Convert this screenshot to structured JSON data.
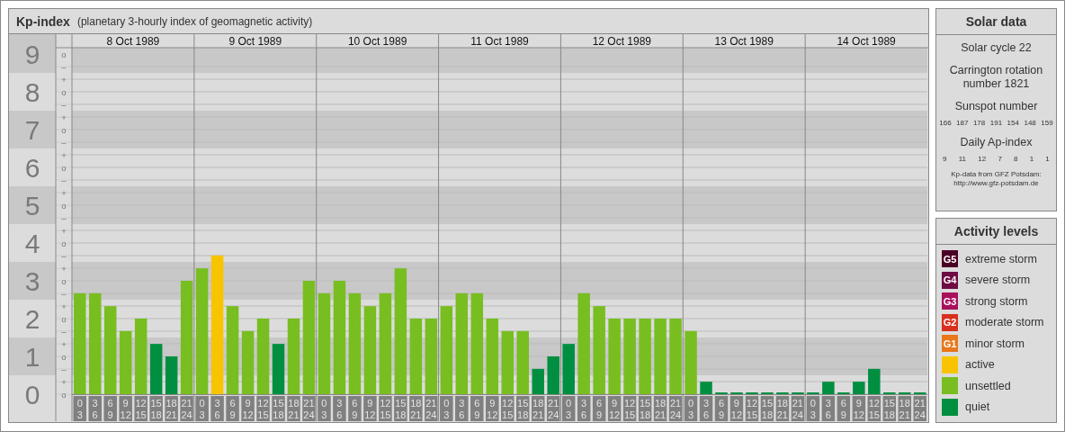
{
  "header": {
    "subtitle": "(planetary 3-hourly index of geomagnetic activity)"
  },
  "kp_chart": {
    "days": [
      {
        "date": "8 Oct 1989",
        "slots": [
          {
            "from": "0",
            "to": "3"
          },
          {
            "from": "3",
            "to": "6"
          },
          {
            "from": "6",
            "to": "9"
          },
          {
            "from": "9",
            "to": "12"
          },
          {
            "from": "12",
            "to": "15"
          },
          {
            "from": "15",
            "to": "18"
          },
          {
            "from": "18",
            "to": "21"
          },
          {
            "from": "21",
            "to": "24"
          }
        ]
      },
      {
        "date": "9 Oct 1989",
        "slots": [
          {
            "from": "0",
            "to": "3"
          },
          {
            "from": "3",
            "to": "6"
          },
          {
            "from": "6",
            "to": "9"
          },
          {
            "from": "9",
            "to": "12"
          },
          {
            "from": "12",
            "to": "15"
          },
          {
            "from": "15",
            "to": "18"
          },
          {
            "from": "18",
            "to": "21"
          },
          {
            "from": "21",
            "to": "24"
          }
        ]
      },
      {
        "date": "10 Oct 1989",
        "slots": [
          {
            "from": "0",
            "to": "3"
          },
          {
            "from": "3",
            "to": "6"
          },
          {
            "from": "6",
            "to": "9"
          },
          {
            "from": "9",
            "to": "12"
          },
          {
            "from": "12",
            "to": "15"
          },
          {
            "from": "15",
            "to": "18"
          },
          {
            "from": "18",
            "to": "21"
          },
          {
            "from": "21",
            "to": "24"
          }
        ]
      },
      {
        "date": "11 Oct 1989",
        "slots": [
          {
            "from": "0",
            "to": "3"
          },
          {
            "from": "3",
            "to": "6"
          },
          {
            "from": "6",
            "to": "9"
          },
          {
            "from": "9",
            "to": "12"
          },
          {
            "from": "12",
            "to": "15"
          },
          {
            "from": "15",
            "to": "18"
          },
          {
            "from": "18",
            "to": "21"
          },
          {
            "from": "21",
            "to": "24"
          }
        ]
      },
      {
        "date": "12 Oct 1989",
        "slots": [
          {
            "from": "0",
            "to": "3"
          },
          {
            "from": "3",
            "to": "6"
          },
          {
            "from": "6",
            "to": "9"
          },
          {
            "from": "9",
            "to": "12"
          },
          {
            "from": "12",
            "to": "15"
          },
          {
            "from": "15",
            "to": "18"
          },
          {
            "from": "18",
            "to": "21"
          },
          {
            "from": "21",
            "to": "24"
          }
        ]
      },
      {
        "date": "13 Oct 1989",
        "slots": [
          {
            "from": "0",
            "to": "3"
          },
          {
            "from": "3",
            "to": "6"
          },
          {
            "from": "6",
            "to": "9"
          },
          {
            "from": "9",
            "to": "12"
          },
          {
            "from": "12",
            "to": "15"
          },
          {
            "from": "15",
            "to": "18"
          },
          {
            "from": "18",
            "to": "21"
          },
          {
            "from": "21",
            "to": "24"
          }
        ]
      },
      {
        "date": "14 Oct 1989",
        "slots": [
          {
            "from": "0",
            "to": "3"
          },
          {
            "from": "3",
            "to": "6"
          },
          {
            "from": "6",
            "to": "9"
          },
          {
            "from": "9",
            "to": "12"
          },
          {
            "from": "12",
            "to": "15"
          },
          {
            "from": "15",
            "to": "18"
          },
          {
            "from": "18",
            "to": "21"
          },
          {
            "from": "21",
            "to": "24"
          }
        ]
      }
    ],
    "minor_ticks": [
      "o",
      "–",
      "+",
      "o",
      "–",
      "+",
      "o",
      "–",
      "+",
      "o",
      "–",
      "+",
      "o",
      "–",
      "+",
      "o",
      "–",
      "+",
      "o",
      "–",
      "+",
      "o",
      "–",
      "+",
      "o",
      "–",
      "+",
      "o"
    ],
    "chart_data": {
      "type": "bar",
      "title": "Kp-index",
      "ylim": [
        0,
        9.1667
      ],
      "grid": true,
      "yticks": [
        {
          "value": 0,
          "label": "0"
        },
        {
          "value": 1,
          "label": "1"
        },
        {
          "value": 2,
          "label": "2"
        },
        {
          "value": 3,
          "label": "3"
        },
        {
          "value": 4,
          "label": "4"
        },
        {
          "value": 5,
          "label": "5"
        },
        {
          "value": 6,
          "label": "6"
        },
        {
          "value": 7,
          "label": "7"
        },
        {
          "value": 8,
          "label": "8"
        },
        {
          "value": 9,
          "label": "9"
        }
      ],
      "series": [
        {
          "values": [
            2.67,
            2.67,
            2.33,
            1.67,
            2,
            1.33,
            1,
            3,
            3.33,
            3.67,
            2.33,
            1.67,
            2,
            1.33,
            2,
            3,
            2.67,
            3,
            2.67,
            2.33,
            2.67,
            3.33,
            2,
            2,
            2.33,
            2.67,
            2.67,
            2,
            1.67,
            1.67,
            0.67,
            1,
            1.33,
            2.67,
            2.33,
            2,
            2,
            2,
            2,
            2,
            1.67,
            0.33,
            0,
            0,
            0,
            0,
            0,
            0,
            0,
            0.33,
            0,
            0.33,
            0.67,
            0,
            0,
            0
          ]
        }
      ]
    }
  },
  "solar_data": {
    "title": "Solar data",
    "cycle": "Solar cycle 22",
    "carrington": "Carrington rotation number 1821",
    "sunspot_label": "Sunspot number",
    "sunspot_numbers": [
      "166",
      "187",
      "178",
      "191",
      "154",
      "148",
      "159"
    ],
    "ap_label": "Daily Ap-index",
    "ap_values": [
      "9",
      "11",
      "12",
      "7",
      "8",
      "1",
      "1"
    ],
    "credit": "Kp-data from GFZ Potsdam:",
    "credit_url": "http://www.gfz-potsdam.de"
  },
  "activity_levels": {
    "title": "Activity levels",
    "items": [
      {
        "badge": "G5",
        "label": "extreme storm",
        "color": "#4a0024"
      },
      {
        "badge": "G4",
        "label": "severe storm",
        "color": "#6e0a44"
      },
      {
        "badge": "G3",
        "label": "strong storm",
        "color": "#a8105c"
      },
      {
        "badge": "G2",
        "label": "moderate storm",
        "color": "#d8301e"
      },
      {
        "badge": "G1",
        "label": "minor storm",
        "color": "#e8781a"
      },
      {
        "label": "active",
        "color": "#f8c400"
      },
      {
        "label": "unsettled",
        "color": "#78be20"
      },
      {
        "label": "quiet",
        "color": "#008f40"
      }
    ]
  }
}
